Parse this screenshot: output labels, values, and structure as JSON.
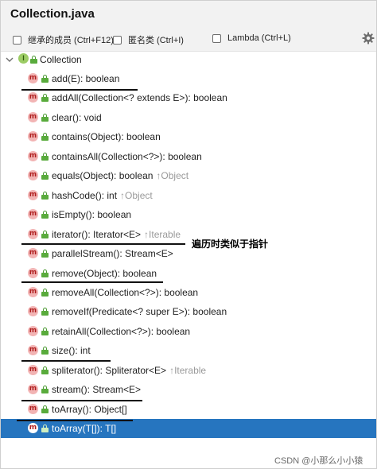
{
  "window": {
    "title": "Collection.java"
  },
  "toolbar": {
    "options": [
      {
        "label": "继承的成员 (Ctrl+F12)",
        "checked": false
      },
      {
        "label": "匿名类 (Ctrl+I)",
        "checked": false
      },
      {
        "label": "Lambda (Ctrl+L)",
        "checked": false
      }
    ],
    "settings_icon": "gear-icon"
  },
  "tree": {
    "root": {
      "label": "Collection",
      "icon": "interface-icon",
      "icon_letter": "I",
      "expanded": true
    },
    "method_icon_letter": "m",
    "methods": [
      {
        "signature": "add(E): boolean",
        "inherited": ""
      },
      {
        "signature": "addAll(Collection<? extends E>): boolean",
        "inherited": ""
      },
      {
        "signature": "clear(): void",
        "inherited": ""
      },
      {
        "signature": "contains(Object): boolean",
        "inherited": ""
      },
      {
        "signature": "containsAll(Collection<?>): boolean",
        "inherited": ""
      },
      {
        "signature": "equals(Object): boolean",
        "inherited": "↑Object"
      },
      {
        "signature": "hashCode(): int",
        "inherited": "↑Object"
      },
      {
        "signature": "isEmpty(): boolean",
        "inherited": ""
      },
      {
        "signature": "iterator(): Iterator<E>",
        "inherited": "↑Iterable"
      },
      {
        "signature": "parallelStream(): Stream<E>",
        "inherited": ""
      },
      {
        "signature": "remove(Object): boolean",
        "inherited": ""
      },
      {
        "signature": "removeAll(Collection<?>): boolean",
        "inherited": ""
      },
      {
        "signature": "removeIf(Predicate<? super E>): boolean",
        "inherited": ""
      },
      {
        "signature": "retainAll(Collection<?>): boolean",
        "inherited": ""
      },
      {
        "signature": "size(): int",
        "inherited": ""
      },
      {
        "signature": "spliterator(): Spliterator<E>",
        "inherited": "↑Iterable"
      },
      {
        "signature": "stream(): Stream<E>",
        "inherited": ""
      },
      {
        "signature": "toArray(): Object[]",
        "inherited": ""
      },
      {
        "signature": "toArray(T[]): T[]",
        "inherited": "",
        "selected": true
      }
    ]
  },
  "annotation": {
    "text": "遍历时类似于指针"
  },
  "watermark": {
    "text": "CSDN @小那么小小猿"
  }
}
